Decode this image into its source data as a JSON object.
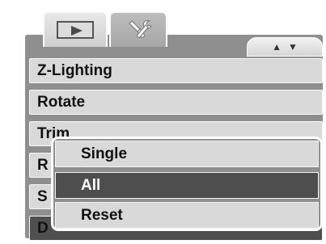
{
  "tabs": [
    {
      "name": "playback",
      "icon": "play-icon",
      "active": true
    },
    {
      "name": "setup",
      "icon": "tools-icon",
      "active": false
    }
  ],
  "scroll_indicator": {
    "up": "▲",
    "down": "▼"
  },
  "menu": {
    "items": [
      {
        "label": "Z-Lighting"
      },
      {
        "label": "Rotate"
      },
      {
        "label": "Trim"
      },
      {
        "label": "R"
      },
      {
        "label": "S"
      },
      {
        "label": "D"
      }
    ]
  },
  "popup": {
    "options": [
      {
        "label": "Single"
      },
      {
        "label": "All",
        "selected": true
      },
      {
        "label": "Reset"
      }
    ]
  },
  "colors": {
    "frame": "#8f8f8f",
    "row": "#d9d9d9",
    "selected": "#4e4e4e"
  }
}
